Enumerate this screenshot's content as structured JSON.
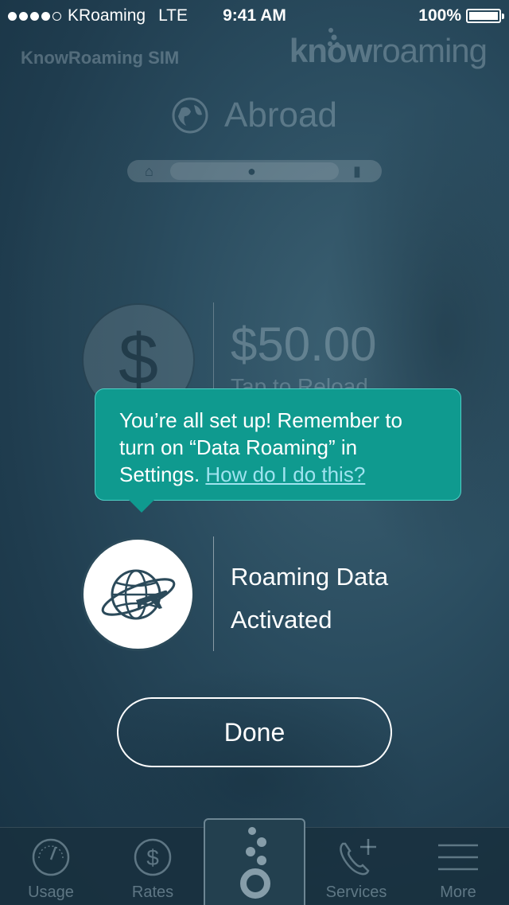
{
  "status_bar": {
    "carrier": "KRoaming",
    "network": "LTE",
    "time": "9:41 AM",
    "battery": "100%"
  },
  "header": {
    "sim_title": "KnowRoaming SIM",
    "logo_bold": "know",
    "logo_light": "roaming",
    "location": "Abroad"
  },
  "balance": {
    "amount": "$50.00",
    "subtitle": "Tap to Reload"
  },
  "tooltip": {
    "message": "You’re all set up! Remember to turn on “Data Roaming” in Settings. ",
    "link": "How do I do this?"
  },
  "status_row": {
    "line1": "Roaming Data",
    "line2": "Activated"
  },
  "done_label": "Done",
  "tabs": [
    {
      "label": "Usage",
      "icon": "speedometer-icon"
    },
    {
      "label": "Rates",
      "icon": "dollar-circle-icon"
    },
    {
      "label": "",
      "icon": "knowroaming-dots-icon"
    },
    {
      "label": "Services",
      "icon": "phone-plus-icon"
    },
    {
      "label": "More",
      "icon": "hamburger-icon"
    }
  ],
  "colors": {
    "tooltip_bg": "#0f9a8f",
    "link": "#9fe3ef",
    "background": "#2a4c5f"
  }
}
